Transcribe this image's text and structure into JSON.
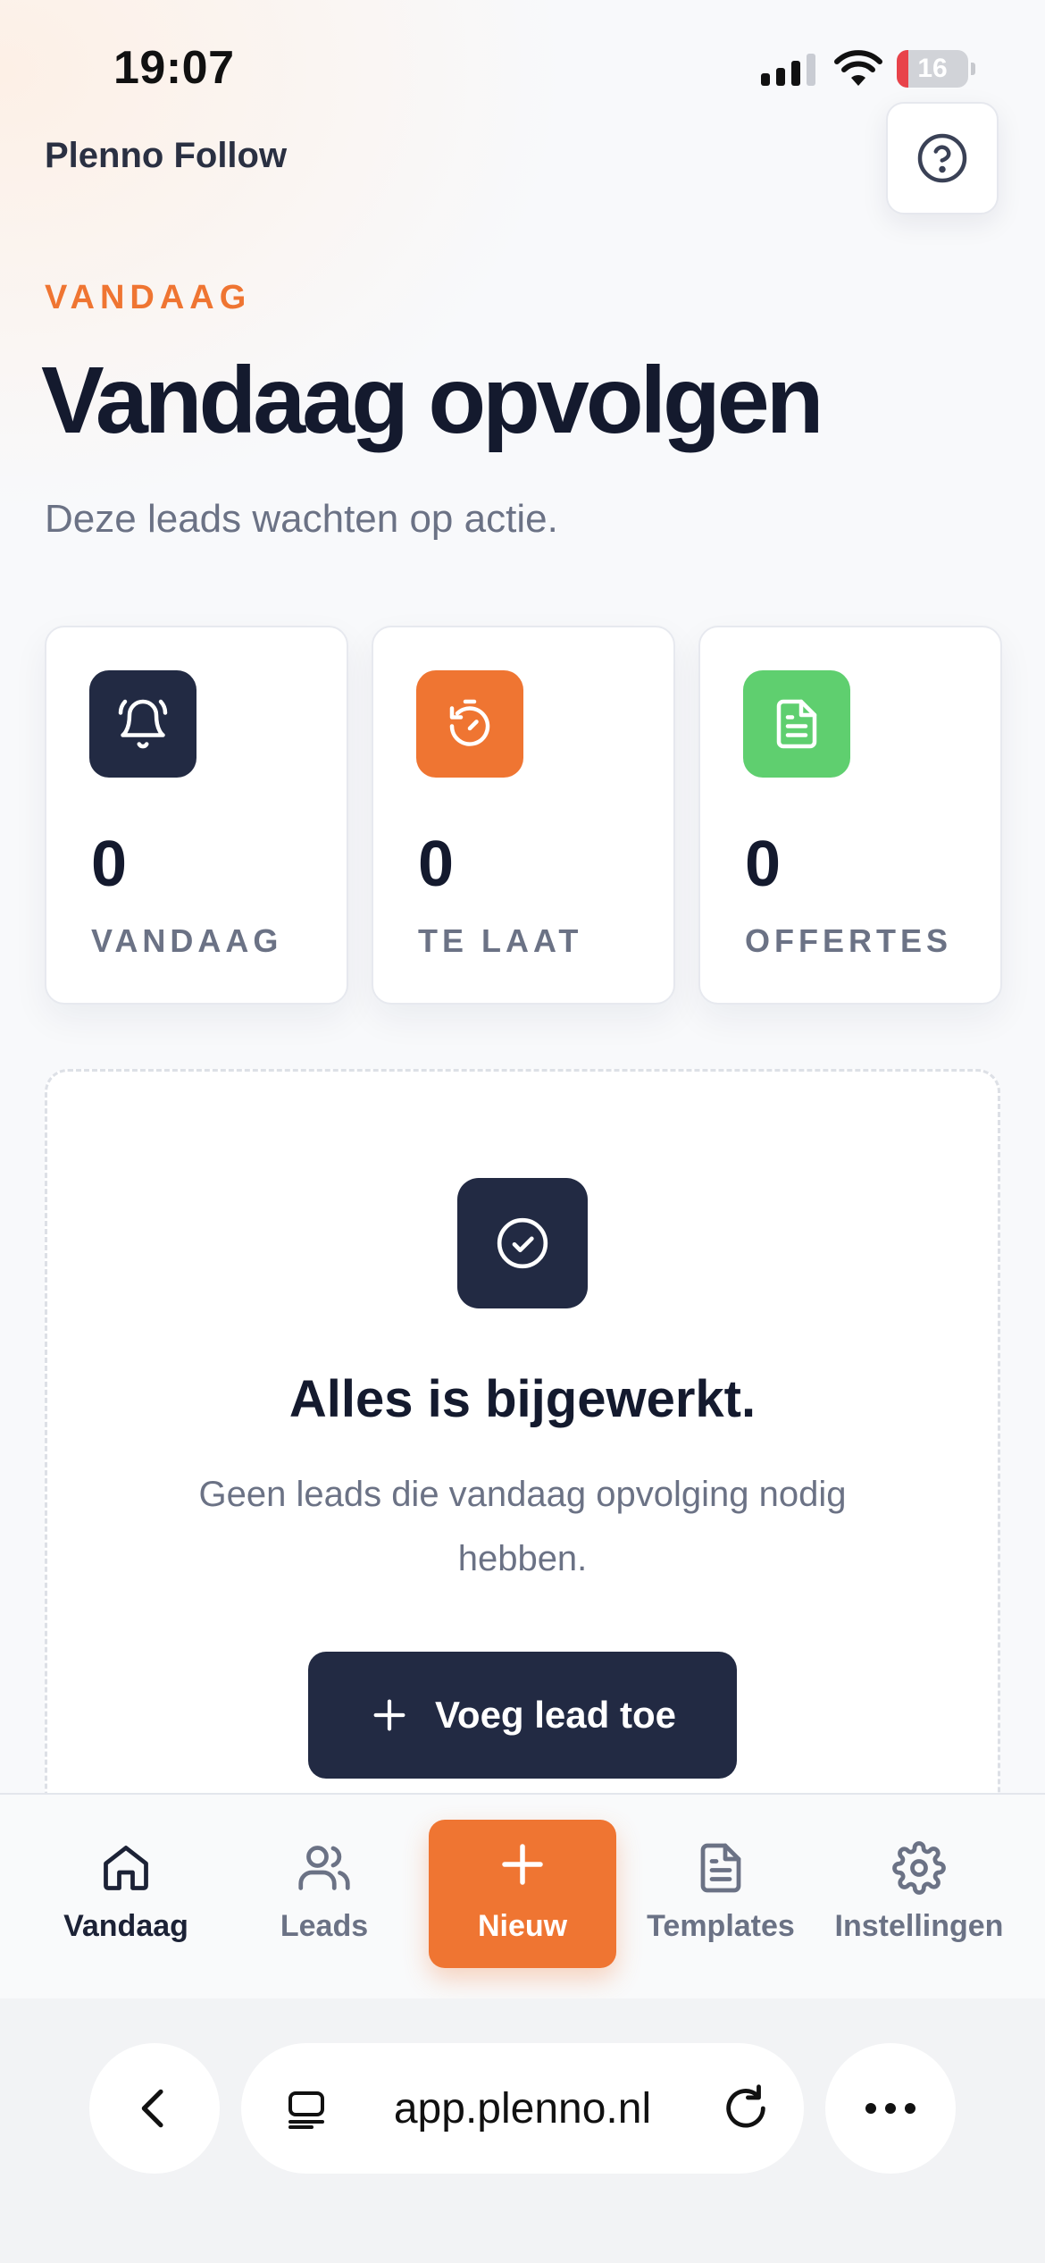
{
  "status_bar": {
    "time": "19:07",
    "battery_level": "16",
    "battery_color": "#e8434a"
  },
  "header": {
    "app_title": "Plenno Follow",
    "help_icon": "question-circle-icon"
  },
  "hero": {
    "eyebrow": "VANDAAG",
    "title": "Vandaag opvolgen",
    "subtitle": "Deze leads wachten op actie."
  },
  "stats": [
    {
      "icon": "bell-icon",
      "icon_bg": "#222a43",
      "value": "0",
      "label": "VANDAAG"
    },
    {
      "icon": "timer-icon",
      "icon_bg": "#ef7532",
      "value": "0",
      "label": "TE LAAT"
    },
    {
      "icon": "document-icon",
      "icon_bg": "#5fcf6f",
      "value": "0",
      "label": "OFFERTES"
    }
  ],
  "empty_state": {
    "icon": "check-circle-icon",
    "title": "Alles is bijgewerkt.",
    "text": "Geen leads die vandaag opvolging nodig hebben.",
    "button_label": "Voeg lead toe",
    "button_icon": "plus-icon"
  },
  "tab_bar": {
    "active": "Vandaag",
    "accent_color": "#ef7532",
    "tabs": [
      {
        "label": "Vandaag",
        "icon": "home-icon"
      },
      {
        "label": "Leads",
        "icon": "users-icon"
      },
      {
        "label": "Nieuw",
        "icon": "plus-icon"
      },
      {
        "label": "Templates",
        "icon": "document-icon"
      },
      {
        "label": "Instellingen",
        "icon": "gear-icon"
      }
    ]
  },
  "browser": {
    "url": "app.plenno.nl",
    "back_icon": "chevron-left-icon",
    "tabs_icon": "tabs-icon",
    "reload_icon": "reload-icon",
    "more_icon": "more-icon"
  }
}
